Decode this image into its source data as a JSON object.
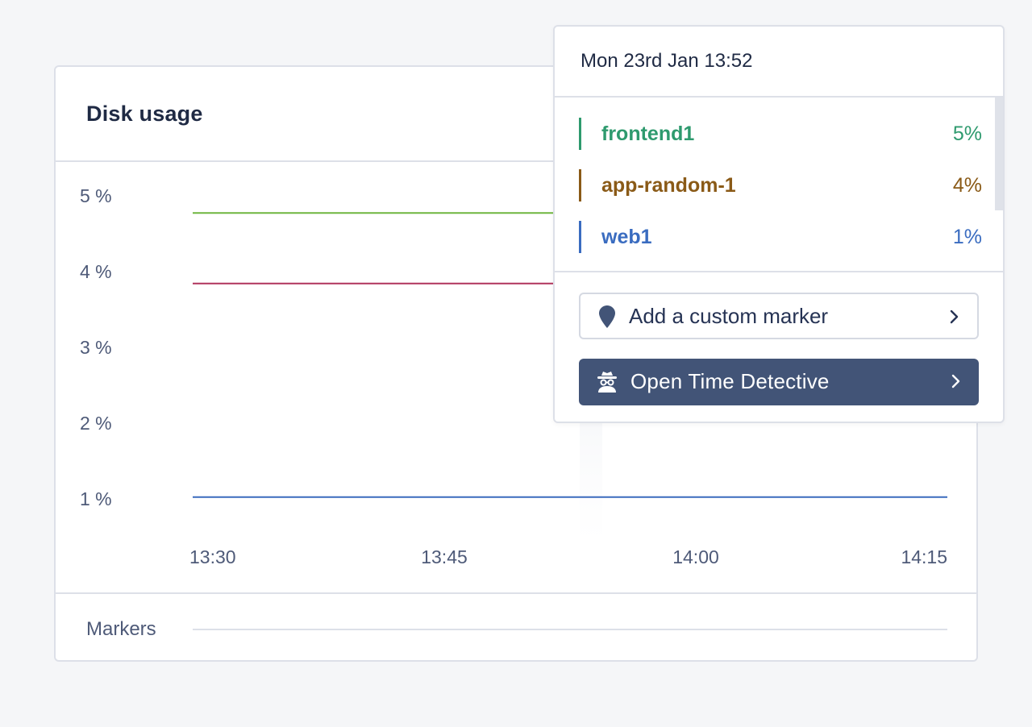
{
  "card": {
    "title": "Disk usage"
  },
  "chart_data": {
    "type": "line",
    "x_labels": [
      "13:30",
      "13:45",
      "14:00",
      "14:15"
    ],
    "y_ticks": [
      "5 %",
      "4 %",
      "3 %",
      "2 %",
      "1 %"
    ],
    "ylim": [
      1,
      5
    ],
    "series": [
      {
        "name": "frontend1",
        "color": "#6fb63f",
        "values": [
          4.88,
          4.88
        ]
      },
      {
        "name": "app-random-1",
        "color": "#b0345c",
        "values": [
          3.95,
          3.95
        ]
      },
      {
        "name": "web1",
        "color": "#3b6bbd",
        "values": [
          1.13,
          1.13
        ]
      }
    ],
    "hover_time": "13:52"
  },
  "markers": {
    "label": "Markers"
  },
  "tooltip": {
    "date": "Mon 23rd Jan 13:52",
    "rows": [
      {
        "name": "frontend1",
        "value": "5%",
        "color": "#2e9a6e"
      },
      {
        "name": "app-random-1",
        "value": "4%",
        "color": "#8a5a17"
      },
      {
        "name": "web1",
        "value": "1%",
        "color": "#3a6cc0"
      }
    ],
    "add_marker_label": "Add a custom marker",
    "detective_label": "Open Time Detective",
    "pin_icon": "map-pin-icon",
    "spy_icon": "spy-icon",
    "chevron_icon": "chevron-right-icon"
  }
}
